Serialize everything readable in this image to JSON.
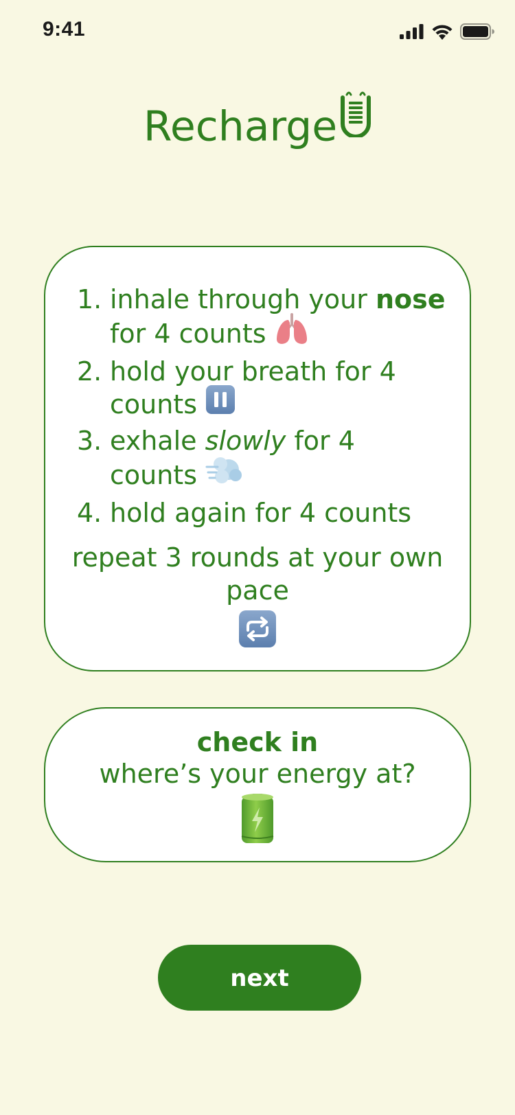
{
  "status_bar": {
    "time": "9:41",
    "icons": [
      "signal-icon",
      "wifi-icon",
      "battery-icon"
    ]
  },
  "header": {
    "title": "Recharge",
    "icon": "battery-face-icon"
  },
  "steps_card": {
    "steps": [
      {
        "number": "1.",
        "pre": "inhale through your ",
        "emphasis": "nose",
        "post": " for 4 counts",
        "emoji": "lungs-icon"
      },
      {
        "number": "2.",
        "pre": "hold your breath for 4 counts",
        "emoji": "pause-icon"
      },
      {
        "number": "3.",
        "pre": "exhale ",
        "emphasis": "slowly",
        "post": " for 4 counts",
        "emoji": "dash-icon"
      },
      {
        "number": "4.",
        "pre": "hold again for 4 counts"
      }
    ],
    "repeat_text": "repeat 3 rounds at your own pace",
    "repeat_icon": "repeat-icon"
  },
  "checkin_card": {
    "title": "check in",
    "subtitle": "where’s your energy at?",
    "icon": "battery-icon"
  },
  "next_button": {
    "label": "next"
  },
  "colors": {
    "background": "#f9f8e3",
    "accent": "#2f7f1f",
    "card": "#ffffff"
  }
}
